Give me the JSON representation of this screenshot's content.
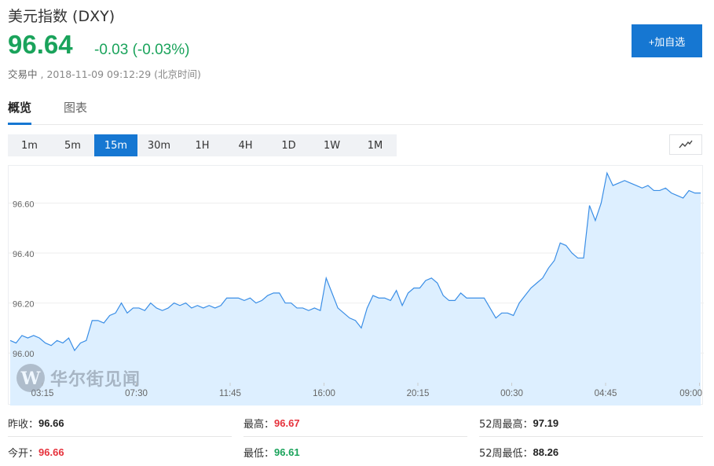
{
  "header": {
    "title": "美元指数 (DXY)",
    "price": "96.64",
    "change": "-0.03 (-0.03%)",
    "status": "交易中",
    "timestamp": "2018-11-09 09:12:29 (北京时间)",
    "add_button": "+加自选",
    "price_color": "#1aa35b",
    "accent": "#1677d2"
  },
  "tabs": [
    {
      "label": "概览",
      "active": true
    },
    {
      "label": "图表",
      "active": false
    }
  ],
  "intervals": [
    "1m",
    "5m",
    "15m",
    "30m",
    "1H",
    "4H",
    "1D",
    "1W",
    "1M"
  ],
  "active_interval": "15m",
  "chart_type_icon": "line-chart-icon",
  "watermark": {
    "text": "华尔街见闻",
    "logo_icon": "wallstreetcn-w-logo-icon"
  },
  "chart_data": {
    "type": "area",
    "ylim": [
      95.9,
      96.73
    ],
    "y_ticks": [
      "96.00",
      "96.20",
      "96.40",
      "96.60"
    ],
    "y_tick_values": [
      96.0,
      96.2,
      96.4,
      96.6
    ],
    "x_ticks": [
      "03:15",
      "07:30",
      "11:45",
      "16:00",
      "20:15",
      "00:30",
      "04:45",
      "09:00"
    ],
    "grid": true,
    "line_color": "#3a8ee6",
    "fill_color": "#ddefff",
    "series": [
      {
        "values": [
          96.05,
          96.04,
          96.07,
          96.06,
          96.07,
          96.06,
          96.04,
          96.03,
          96.05,
          96.04,
          96.06,
          96.01,
          96.04,
          96.05,
          96.13,
          96.13,
          96.12,
          96.15,
          96.16,
          96.2,
          96.16,
          96.18,
          96.18,
          96.17,
          96.2,
          96.18,
          96.17,
          96.18,
          96.2,
          96.19,
          96.2,
          96.18,
          96.19,
          96.18,
          96.19,
          96.18,
          96.19,
          96.22,
          96.22,
          96.22,
          96.21,
          96.22,
          96.2,
          96.21,
          96.23,
          96.24,
          96.24,
          96.2,
          96.2,
          96.18,
          96.18,
          96.17,
          96.18,
          96.17,
          96.3,
          96.24,
          96.18,
          96.16,
          96.14,
          96.13,
          96.1,
          96.18,
          96.23,
          96.22,
          96.22,
          96.21,
          96.25,
          96.19,
          96.24,
          96.26,
          96.26,
          96.29,
          96.3,
          96.28,
          96.23,
          96.21,
          96.21,
          96.24,
          96.22,
          96.22,
          96.22,
          96.22,
          96.18,
          96.14,
          96.16,
          96.16,
          96.15,
          96.2,
          96.23,
          96.26,
          96.28,
          96.3,
          96.34,
          96.37,
          96.44,
          96.43,
          96.4,
          96.38,
          96.38,
          96.59,
          96.53,
          96.6,
          96.72,
          96.67,
          96.68,
          96.69,
          96.68,
          96.67,
          96.66,
          96.67,
          96.65,
          96.65,
          96.66,
          96.64,
          96.63,
          96.62,
          96.65,
          96.64,
          96.64
        ]
      }
    ]
  },
  "stats": [
    {
      "label": "昨收：",
      "value": "96.66",
      "color": "black"
    },
    {
      "label": "最高：",
      "value": "96.67",
      "color": "red"
    },
    {
      "label": "52周最高：",
      "value": "97.19",
      "color": "black"
    },
    {
      "label": "今开：",
      "value": "96.66",
      "color": "red"
    },
    {
      "label": "最低：",
      "value": "96.61",
      "color": "green"
    },
    {
      "label": "52周最低：",
      "value": "88.26",
      "color": "black"
    }
  ]
}
